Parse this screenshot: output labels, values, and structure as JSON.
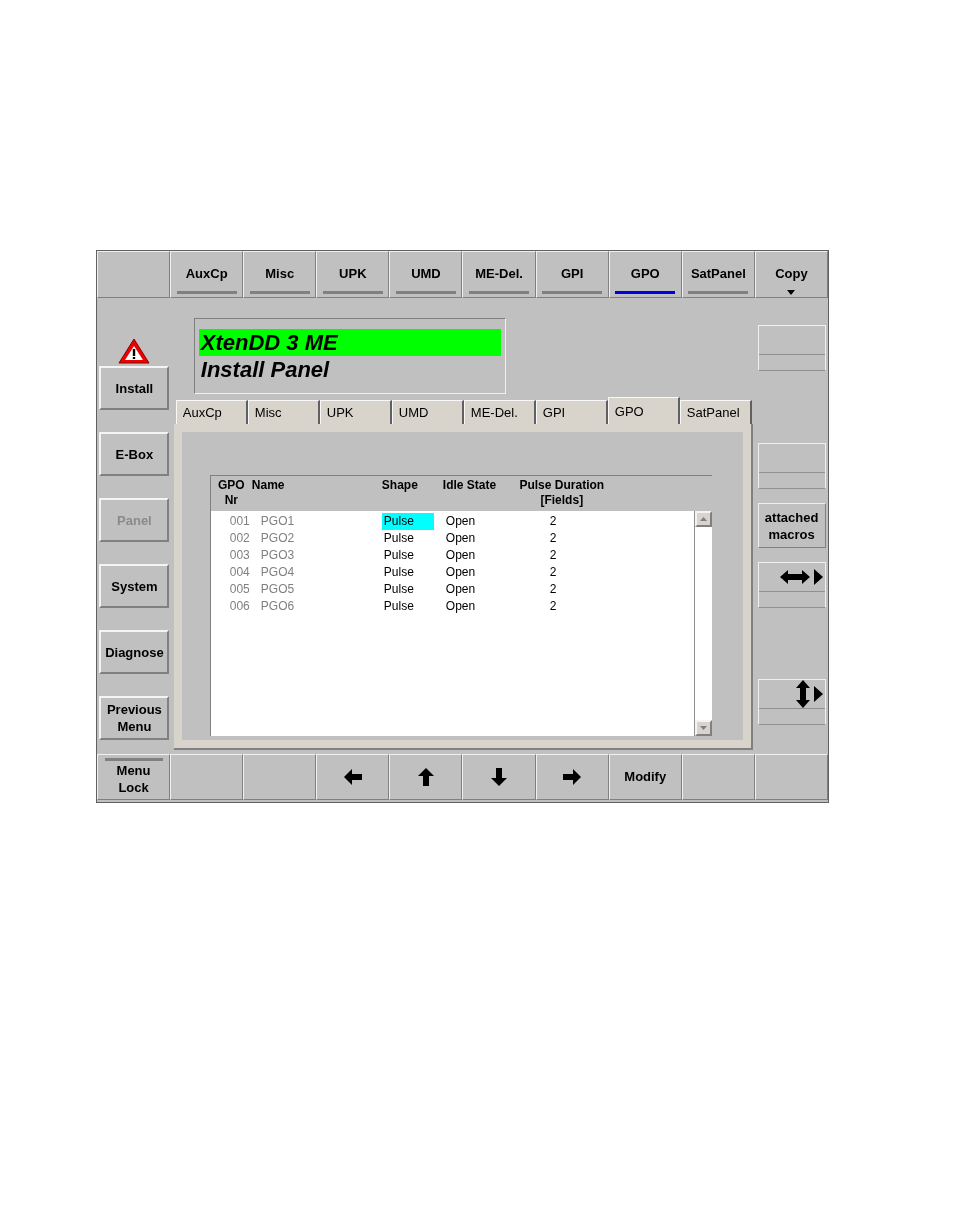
{
  "top_menu": [
    {
      "label": "AuxCp",
      "selected": false
    },
    {
      "label": "Misc",
      "selected": false
    },
    {
      "label": "UPK",
      "selected": false
    },
    {
      "label": "UMD",
      "selected": false
    },
    {
      "label": "ME-Del.",
      "selected": false
    },
    {
      "label": "GPI",
      "selected": false
    },
    {
      "label": "GPO",
      "selected": true
    },
    {
      "label": "SatPanel",
      "selected": false
    }
  ],
  "copy_button": {
    "label": "Copy"
  },
  "side_menu": [
    {
      "label": "Install",
      "disabled": false,
      "warning": true
    },
    {
      "label": "E-Box",
      "disabled": false,
      "warning": false
    },
    {
      "label": "Panel",
      "disabled": true,
      "warning": false
    },
    {
      "label": "System",
      "disabled": false,
      "warning": false
    },
    {
      "label": "Diagnose",
      "disabled": false,
      "warning": false
    },
    {
      "label": "Previous Menu",
      "disabled": false,
      "warning": false
    }
  ],
  "header": {
    "title": "XtenDD 3 ME",
    "subtitle": "Install Panel"
  },
  "tabs": [
    {
      "label": "AuxCp",
      "selected": false
    },
    {
      "label": "Misc",
      "selected": false
    },
    {
      "label": "UPK",
      "selected": false
    },
    {
      "label": "UMD",
      "selected": false
    },
    {
      "label": "ME-Del.",
      "selected": false
    },
    {
      "label": "GPI",
      "selected": false
    },
    {
      "label": "GPO",
      "selected": true
    },
    {
      "label": "SatPanel",
      "selected": false
    }
  ],
  "table": {
    "columns": [
      {
        "lines": [
          "GPO",
          "Nr"
        ]
      },
      {
        "lines": [
          "Name"
        ]
      },
      {
        "lines": [
          "Shape"
        ]
      },
      {
        "lines": [
          "Idle State"
        ]
      },
      {
        "lines": [
          "Pulse Duration",
          "[Fields]"
        ]
      }
    ],
    "rows": [
      {
        "nr": "001",
        "name": "PGO1",
        "shape": "Pulse",
        "idle_state": "Open",
        "pulse_duration": "2",
        "selected": true
      },
      {
        "nr": "002",
        "name": "PGO2",
        "shape": "Pulse",
        "idle_state": "Open",
        "pulse_duration": "2",
        "selected": false
      },
      {
        "nr": "003",
        "name": "PGO3",
        "shape": "Pulse",
        "idle_state": "Open",
        "pulse_duration": "2",
        "selected": false
      },
      {
        "nr": "004",
        "name": "PGO4",
        "shape": "Pulse",
        "idle_state": "Open",
        "pulse_duration": "2",
        "selected": false
      },
      {
        "nr": "005",
        "name": "PGO5",
        "shape": "Pulse",
        "idle_state": "Open",
        "pulse_duration": "2",
        "selected": false
      },
      {
        "nr": "006",
        "name": "PGO6",
        "shape": "Pulse",
        "idle_state": "Open",
        "pulse_duration": "2",
        "selected": false
      }
    ]
  },
  "right_menu": [
    {
      "kind": "empty"
    },
    {
      "kind": "empty"
    },
    {
      "kind": "text",
      "label": "attached macros"
    },
    {
      "kind": "horizontal"
    },
    {
      "kind": "vertical"
    }
  ],
  "bottom_menu": [
    {
      "kind": "toggle",
      "label": "Menu Lock"
    },
    {
      "kind": "empty"
    },
    {
      "kind": "empty"
    },
    {
      "kind": "left"
    },
    {
      "kind": "up"
    },
    {
      "kind": "down"
    },
    {
      "kind": "right"
    },
    {
      "kind": "text",
      "label": "Modify"
    },
    {
      "kind": "empty"
    },
    {
      "kind": "empty"
    }
  ]
}
